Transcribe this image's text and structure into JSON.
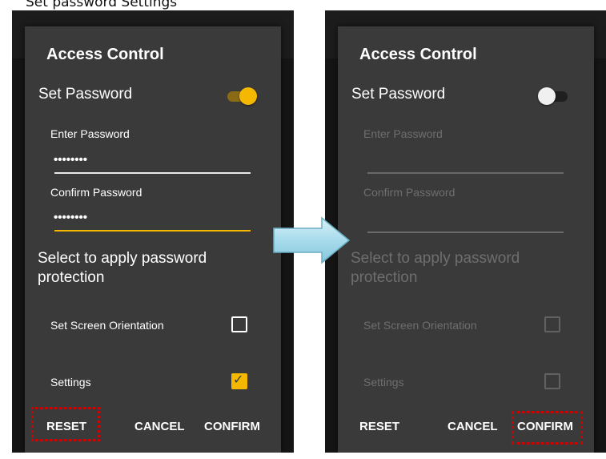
{
  "caption": "Set password Settings",
  "colors": {
    "accent": "#f5b800",
    "dialog_bg": "#3a3a3a",
    "disabled_text": "#6e6e6e",
    "highlight": "#d40000",
    "arrow": "#a8dcec"
  },
  "left": {
    "title": "Access Control",
    "set_password_label": "Set Password",
    "switch_state": "on",
    "enter_password_label": "Enter Password",
    "enter_password_value": "••••••••",
    "confirm_password_label": "Confirm Password",
    "confirm_password_value": "••••••••",
    "section_text": "Select to apply password protection",
    "options": [
      {
        "label": "Set Screen Orientation",
        "checked": false
      },
      {
        "label": "Settings",
        "checked": true
      }
    ],
    "buttons": {
      "reset": "RESET",
      "cancel": "CANCEL",
      "confirm": "CONFIRM"
    },
    "highlighted_button": "reset"
  },
  "right": {
    "title": "Access Control",
    "set_password_label": "Set Password",
    "switch_state": "off",
    "enter_password_label": "Enter Password",
    "confirm_password_label": "Confirm Password",
    "section_text": "Select to apply password protection",
    "options": [
      {
        "label": "Set Screen Orientation",
        "checked": false
      },
      {
        "label": "Settings",
        "checked": false
      }
    ],
    "buttons": {
      "reset": "RESET",
      "cancel": "CANCEL",
      "confirm": "CONFIRM"
    },
    "highlighted_button": "confirm"
  }
}
